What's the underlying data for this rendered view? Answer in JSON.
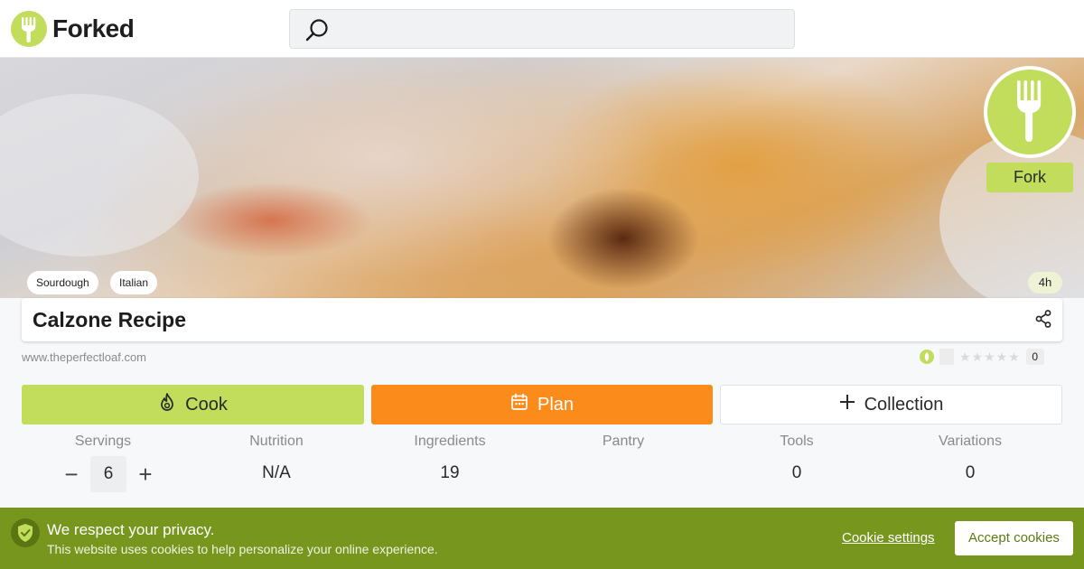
{
  "header": {
    "brand": "Forked",
    "search_placeholder": ""
  },
  "hero": {
    "fork_label": "Fork",
    "tags": [
      "Sourdough",
      "Italian"
    ],
    "time": "4h"
  },
  "recipe": {
    "title": "Calzone Recipe",
    "source": "www.theperfectloaf.com",
    "rating_count": "0",
    "stars": "★★★★★"
  },
  "actions": {
    "cook": "Cook",
    "plan": "Plan",
    "collection": "Collection"
  },
  "stats": {
    "servings_label": "Servings",
    "servings_value": "6",
    "minus": "−",
    "plus": "+",
    "nutrition_label": "Nutrition",
    "nutrition_value": "N/A",
    "ingredients_label": "Ingredients",
    "ingredients_value": "19",
    "pantry_label": "Pantry",
    "pantry_value": "",
    "tools_label": "Tools",
    "tools_value": "0",
    "variations_label": "Variations",
    "variations_value": "0"
  },
  "cookie": {
    "title": "We respect your privacy.",
    "text": "This website uses cookies to help personalize your online experience.",
    "settings": "Cookie settings",
    "accept": "Accept cookies"
  },
  "colors": {
    "brand_green": "#c2dc5c",
    "plan_orange": "#fb8c1c",
    "cookie_green": "#77961d"
  }
}
